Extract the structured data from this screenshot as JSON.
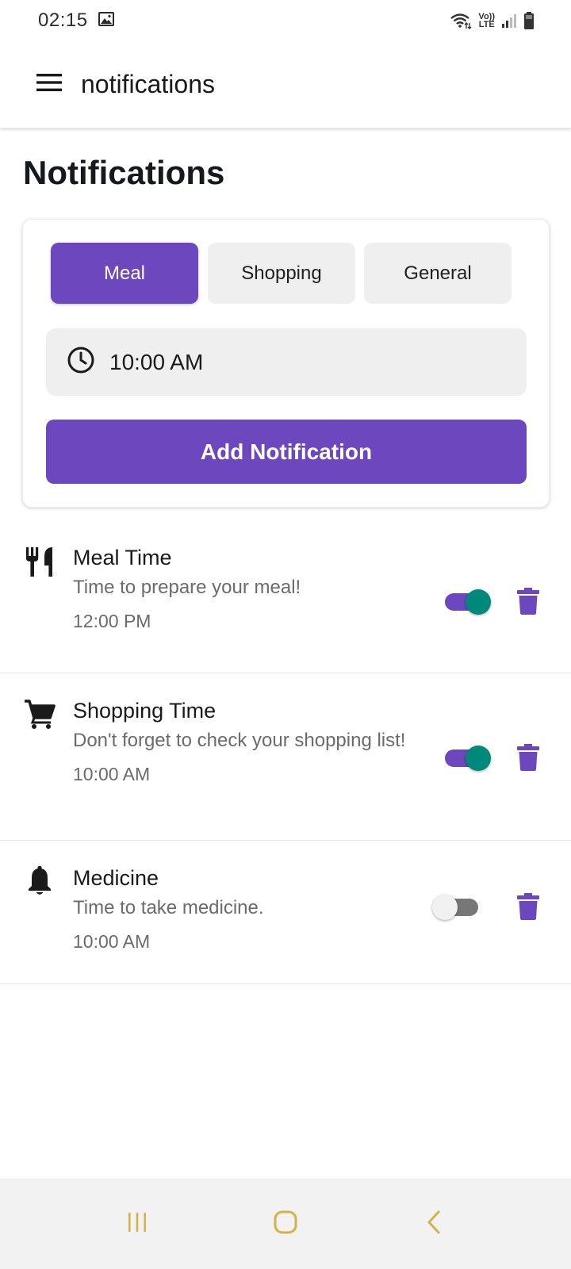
{
  "status_bar": {
    "time": "02:15",
    "lte_top": "Vo))",
    "lte_bottom": "LTE"
  },
  "app_bar": {
    "menu_icon": "hamburger-menu-icon",
    "title": "notifications"
  },
  "page": {
    "heading": "Notifications"
  },
  "form": {
    "tabs": [
      {
        "label": "Meal",
        "active": true
      },
      {
        "label": "Shopping",
        "active": false
      },
      {
        "label": "General",
        "active": false
      }
    ],
    "time_icon": "clock-icon",
    "time_value": "10:00 AM",
    "add_button_label": "Add Notification"
  },
  "notifications": [
    {
      "icon": "fork-knife-icon",
      "title": "Meal Time",
      "message": "Time to prepare your meal!",
      "time": "12:00 PM",
      "enabled": true
    },
    {
      "icon": "shopping-cart-icon",
      "title": "Shopping Time",
      "message": "Don't forget to check your shopping list!",
      "time": "10:00 AM",
      "enabled": true
    },
    {
      "icon": "bell-icon",
      "title": "Medicine",
      "message": "Time to take medicine.",
      "time": "10:00 AM",
      "enabled": false
    }
  ],
  "colors": {
    "primary": "#6d47be",
    "toggle_on_thumb": "#00897b",
    "toggle_off_track": "#777777",
    "tab_inactive_bg": "#efefef",
    "system_nav_bg": "#f2f2f2",
    "system_nav_icon": "#d4b24a"
  },
  "system_nav": [
    "recent-apps-icon",
    "home-icon",
    "back-icon"
  ]
}
